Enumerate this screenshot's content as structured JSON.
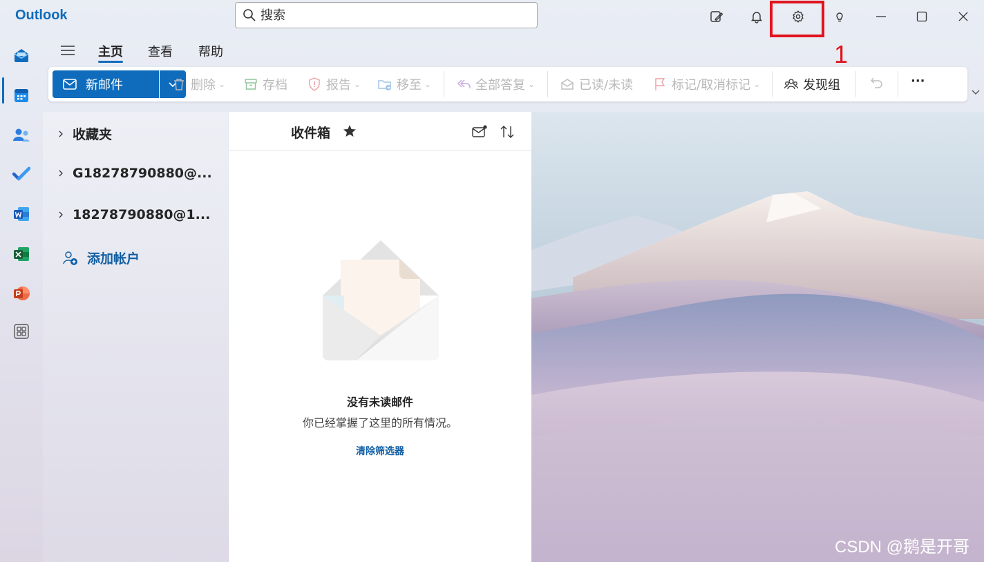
{
  "app": {
    "title": "Outlook"
  },
  "search": {
    "placeholder": "搜索"
  },
  "ribbon_tabs": [
    {
      "label": "主页",
      "active": true
    },
    {
      "label": "查看",
      "active": false
    },
    {
      "label": "帮助",
      "active": false
    }
  ],
  "ribbon": {
    "new_mail": "新邮件",
    "delete": "删除",
    "archive": "存档",
    "report": "报告",
    "move_to": "移至",
    "reply_all": "全部答复",
    "read_unread": "已读/未读",
    "flag": "标记/取消标记",
    "discover_groups": "发现组",
    "more": "···"
  },
  "folders": {
    "items": [
      {
        "label": "收藏夹"
      },
      {
        "label": "G18278790880@..."
      },
      {
        "label": "18278790880@1..."
      }
    ],
    "add_account": "添加帐户"
  },
  "message_list": {
    "title": "收件箱",
    "empty_title": "没有未读邮件",
    "empty_subtitle": "你已经掌握了这里的所有情况。",
    "clear_filter": "清除筛选器"
  },
  "annotation": {
    "label": "1",
    "color": "#e0141e"
  },
  "watermark": "CSDN @鹅是开哥",
  "colors": {
    "accent": "#0f6cbd",
    "link": "#115ea3"
  },
  "icons": {
    "titlebar": [
      "compose-notes-icon",
      "bell-icon",
      "gear-icon",
      "lightbulb-icon",
      "minimize-icon",
      "maximize-icon",
      "close-icon"
    ],
    "rail": [
      "mail-icon",
      "calendar-icon",
      "people-icon",
      "todo-icon",
      "word-icon",
      "excel-icon",
      "powerpoint-icon",
      "apps-icon"
    ]
  }
}
